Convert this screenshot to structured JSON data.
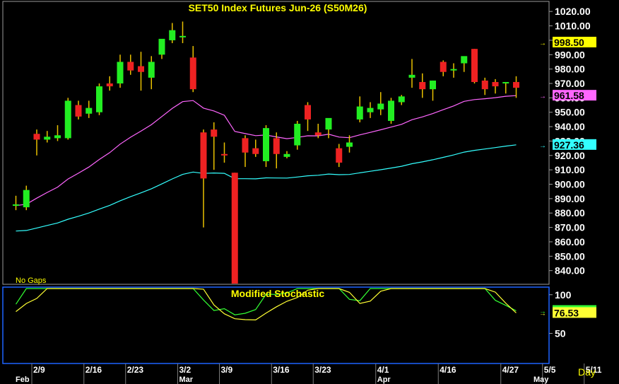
{
  "chart_data": [
    {
      "type": "candlestick",
      "title": "SET50  Index  Futures  Jun-26  (S50M26)",
      "note": "No  Gaps",
      "ylim": [
        831,
        1026
      ],
      "y_ticks": [
        "1020.00",
        "1010.00",
        "1000.00",
        "990.00",
        "980.00",
        "970.00",
        "960.00",
        "950.00",
        "940.00",
        "930.00",
        "920.00",
        "910.00",
        "900.00",
        "890.00",
        "880.00",
        "870.00",
        "860.00",
        "850.00",
        "840.00"
      ],
      "y_tick_values": [
        1020,
        1010,
        1000,
        990,
        980,
        970,
        960,
        950,
        940,
        930,
        920,
        910,
        900,
        890,
        880,
        870,
        860,
        850,
        840
      ],
      "x_ticks": [
        {
          "label": "2/9",
          "index": 2
        },
        {
          "label": "2/16",
          "index": 7
        },
        {
          "label": "2/23",
          "index": 11
        },
        {
          "label": "3/2",
          "index": 16
        },
        {
          "label": "3/9",
          "index": 20
        },
        {
          "label": "3/16",
          "index": 25
        },
        {
          "label": "3/23",
          "index": 29
        },
        {
          "label": "4/1",
          "index": 35
        },
        {
          "label": "4/16",
          "index": 41
        },
        {
          "label": "4/27",
          "index": 47
        },
        {
          "label": "5/5",
          "index": 51
        },
        {
          "label": "5/11",
          "index": 55
        }
      ],
      "month_labels": [
        {
          "label": "Feb",
          "index": 0
        },
        {
          "label": "Mar",
          "index": 16
        },
        {
          "label": "Apr",
          "index": 35
        },
        {
          "label": "May",
          "index": 50
        }
      ],
      "candles": [
        {
          "o": 885,
          "h": 892,
          "l": 882,
          "c": 886
        },
        {
          "o": 884,
          "h": 899,
          "l": 882,
          "c": 896
        },
        {
          "o": 935,
          "h": 938,
          "l": 920,
          "c": 931
        },
        {
          "o": 931,
          "h": 937,
          "l": 929,
          "c": 933
        },
        {
          "o": 932,
          "h": 941,
          "l": 930,
          "c": 934
        },
        {
          "o": 932,
          "h": 960,
          "l": 931,
          "c": 958
        },
        {
          "o": 955,
          "h": 958,
          "l": 945,
          "c": 947
        },
        {
          "o": 949,
          "h": 958,
          "l": 946,
          "c": 953
        },
        {
          "o": 950,
          "h": 970,
          "l": 948,
          "c": 968
        },
        {
          "o": 970,
          "h": 975,
          "l": 965,
          "c": 968
        },
        {
          "o": 970,
          "h": 990,
          "l": 967,
          "c": 985
        },
        {
          "o": 985,
          "h": 990,
          "l": 976,
          "c": 979
        },
        {
          "o": 982,
          "h": 992,
          "l": 965,
          "c": 978
        },
        {
          "o": 974,
          "h": 989,
          "l": 966,
          "c": 985
        },
        {
          "o": 990,
          "h": 1000,
          "l": 987,
          "c": 1001
        },
        {
          "o": 1000,
          "h": 1012,
          "l": 998,
          "c": 1007
        },
        {
          "o": 1003,
          "h": 1013,
          "l": 998,
          "c": 1003
        },
        {
          "o": 988,
          "h": 996,
          "l": 964,
          "c": 966
        },
        {
          "o": 936,
          "h": 938,
          "l": 870,
          "c": 904
        },
        {
          "o": 938,
          "h": 943,
          "l": 910,
          "c": 933
        },
        {
          "o": 921,
          "h": 929,
          "l": 915,
          "c": 920
        },
        {
          "o": 908,
          "h": 908,
          "l": 831,
          "c": 831
        },
        {
          "o": 932,
          "h": 934,
          "l": 912,
          "c": 922
        },
        {
          "o": 925,
          "h": 931,
          "l": 919,
          "c": 921
        },
        {
          "o": 916,
          "h": 941,
          "l": 912,
          "c": 939
        },
        {
          "o": 932,
          "h": 936,
          "l": 911,
          "c": 921
        },
        {
          "o": 919,
          "h": 923,
          "l": 918,
          "c": 921
        },
        {
          "o": 927,
          "h": 944,
          "l": 924,
          "c": 942
        },
        {
          "o": 955,
          "h": 957,
          "l": 937,
          "c": 945
        },
        {
          "o": 936,
          "h": 942,
          "l": 932,
          "c": 934
        },
        {
          "o": 938,
          "h": 945,
          "l": 932,
          "c": 946
        },
        {
          "o": 925,
          "h": 928,
          "l": 912,
          "c": 915
        },
        {
          "o": 926,
          "h": 934,
          "l": 922,
          "c": 929
        },
        {
          "o": 945,
          "h": 961,
          "l": 943,
          "c": 954
        },
        {
          "o": 950,
          "h": 957,
          "l": 946,
          "c": 953
        },
        {
          "o": 952,
          "h": 964,
          "l": 948,
          "c": 956
        },
        {
          "o": 944,
          "h": 960,
          "l": 942,
          "c": 958
        },
        {
          "o": 957,
          "h": 962,
          "l": 955,
          "c": 961
        },
        {
          "o": 974,
          "h": 987,
          "l": 967,
          "c": 976
        },
        {
          "o": 971,
          "h": 977,
          "l": 960,
          "c": 966
        },
        {
          "o": 966,
          "h": 972,
          "l": 958,
          "c": 972
        },
        {
          "o": 985,
          "h": 986,
          "l": 975,
          "c": 978
        },
        {
          "o": 980,
          "h": 984,
          "l": 974,
          "c": 980
        },
        {
          "o": 984,
          "h": 986,
          "l": 978,
          "c": 989
        },
        {
          "o": 994,
          "h": 994,
          "l": 970,
          "c": 971
        },
        {
          "o": 972,
          "h": 974,
          "l": 962,
          "c": 966
        },
        {
          "o": 971,
          "h": 973,
          "l": 963,
          "c": 968
        },
        {
          "o": 971,
          "h": 971,
          "l": 963,
          "c": 971
        },
        {
          "o": 971,
          "h": 975,
          "l": 960,
          "c": 967
        }
      ]
    },
    {
      "type": "line",
      "title": "Modified  Stochastic",
      "ylim": [
        12,
        108
      ],
      "y_ticks": [
        "100",
        "50"
      ],
      "y_tick_values": [
        100,
        50
      ],
      "series": [
        {
          "color": "#33ff33"
        },
        {
          "color": "#ffff33"
        }
      ]
    }
  ],
  "price_labels": [
    {
      "text": "998.50",
      "value": 998.5,
      "bg": "#ffff00"
    },
    {
      "text": "961.58",
      "value": 961.58,
      "bg": "#ff66ff"
    },
    {
      "text": "927.36",
      "value": 927.36,
      "bg": "#33ffff"
    }
  ],
  "stoch_labels": [
    {
      "text": "79.17",
      "value": 79.17,
      "bg": "#33ff33"
    },
    {
      "text": "76.53",
      "value": 76.53,
      "bg": "#ffff33"
    }
  ],
  "x_unit": "Day"
}
